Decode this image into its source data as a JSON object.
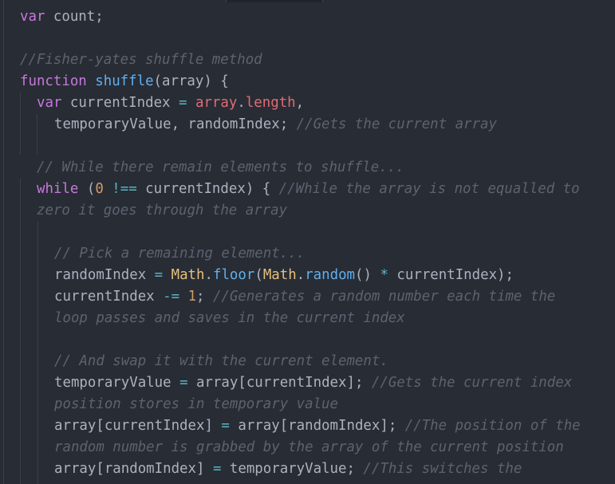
{
  "editor": {
    "lines": [
      [
        {
          "t": "var",
          "k": "kw"
        },
        {
          "t": " count;",
          "k": "p"
        }
      ],
      [
        {
          "t": "//Fisher-yates shuffle method",
          "k": "cm"
        }
      ],
      [
        {
          "t": "function",
          "k": "kw"
        },
        {
          "t": " ",
          "k": "p"
        },
        {
          "t": "shuffle",
          "k": "fn"
        },
        {
          "t": "(array) {",
          "k": "p"
        }
      ],
      [
        {
          "t": "var",
          "k": "kw"
        },
        {
          "t": " currentIndex ",
          "k": "p"
        },
        {
          "t": "=",
          "k": "op"
        },
        {
          "t": " ",
          "k": "p"
        },
        {
          "t": "array",
          "k": "var"
        },
        {
          "t": ".",
          "k": "p"
        },
        {
          "t": "length",
          "k": "var"
        },
        {
          "t": ",",
          "k": "p"
        }
      ],
      [
        {
          "t": "temporaryValue, randomIndex; ",
          "k": "p"
        },
        {
          "t": "//Gets the current array",
          "k": "cm"
        }
      ],
      [
        {
          "t": "// While there remain elements to shuffle...",
          "k": "cm"
        }
      ],
      [
        {
          "t": "while",
          "k": "kw"
        },
        {
          "t": " (",
          "k": "p"
        },
        {
          "t": "0",
          "k": "num"
        },
        {
          "t": " ",
          "k": "p"
        },
        {
          "t": "!==",
          "k": "op"
        },
        {
          "t": " currentIndex) { ",
          "k": "p"
        },
        {
          "t": "//While the array is not equalled to",
          "k": "cm"
        }
      ],
      [
        {
          "t": "zero it goes through the array",
          "k": "cm"
        }
      ],
      [
        {
          "t": "// Pick a remaining element...",
          "k": "cm"
        }
      ],
      [
        {
          "t": "randomIndex ",
          "k": "p"
        },
        {
          "t": "=",
          "k": "op"
        },
        {
          "t": " ",
          "k": "p"
        },
        {
          "t": "Math",
          "k": "cls"
        },
        {
          "t": ".",
          "k": "p"
        },
        {
          "t": "floor",
          "k": "fn"
        },
        {
          "t": "(",
          "k": "p"
        },
        {
          "t": "Math",
          "k": "cls"
        },
        {
          "t": ".",
          "k": "p"
        },
        {
          "t": "random",
          "k": "fn"
        },
        {
          "t": "() ",
          "k": "p"
        },
        {
          "t": "*",
          "k": "op"
        },
        {
          "t": " currentIndex);",
          "k": "p"
        }
      ],
      [
        {
          "t": "currentIndex ",
          "k": "p"
        },
        {
          "t": "-=",
          "k": "op"
        },
        {
          "t": " ",
          "k": "p"
        },
        {
          "t": "1",
          "k": "num"
        },
        {
          "t": "; ",
          "k": "p"
        },
        {
          "t": "//Generates a random number each time the",
          "k": "cm"
        }
      ],
      [
        {
          "t": "loop passes and saves in the current index",
          "k": "cm"
        }
      ],
      [
        {
          "t": "// And swap it with the current element.",
          "k": "cm"
        }
      ],
      [
        {
          "t": "temporaryValue ",
          "k": "p"
        },
        {
          "t": "=",
          "k": "op"
        },
        {
          "t": " array[currentIndex]; ",
          "k": "p"
        },
        {
          "t": "//Gets the current index",
          "k": "cm"
        }
      ],
      [
        {
          "t": "position stores in temporary value",
          "k": "cm"
        }
      ],
      [
        {
          "t": "array[currentIndex] ",
          "k": "p"
        },
        {
          "t": "=",
          "k": "op"
        },
        {
          "t": " array[randomIndex]; ",
          "k": "p"
        },
        {
          "t": "//The position of the",
          "k": "cm"
        }
      ],
      [
        {
          "t": "random number is grabbed by the array of the current position",
          "k": "cm"
        }
      ],
      [
        {
          "t": "array[randomIndex] ",
          "k": "p"
        },
        {
          "t": "=",
          "k": "op"
        },
        {
          "t": " temporaryValue; ",
          "k": "p"
        },
        {
          "t": "//This switches the",
          "k": "cm"
        }
      ]
    ]
  }
}
